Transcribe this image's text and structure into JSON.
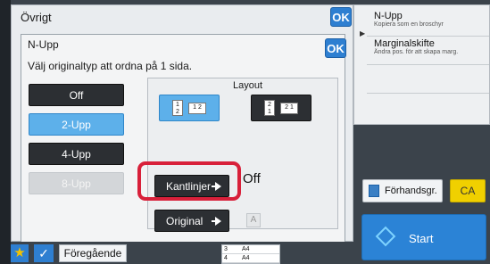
{
  "base_dialog": {
    "title": "Övrigt",
    "ok_label": "OK"
  },
  "dialog": {
    "title": "N-Upp",
    "ok_label": "OK",
    "instruction": "Välj originaltyp att ordna på 1 sida.",
    "options": [
      {
        "label": "Off",
        "state": "normal"
      },
      {
        "label": "2-Upp",
        "state": "selected"
      },
      {
        "label": "4-Upp",
        "state": "normal"
      },
      {
        "label": "8-Upp",
        "state": "disabled"
      }
    ],
    "layout_label": "Layout",
    "layout_options": [
      {
        "pages": [
          "1",
          "2"
        ],
        "order": "1 2",
        "state": "selected"
      },
      {
        "pages": [
          "2",
          "1"
        ],
        "order": "2 1",
        "state": "normal"
      }
    ],
    "border_button": "Kantlinjer",
    "border_value": "Off",
    "original_button": "Original",
    "a_label": "A"
  },
  "side_list": {
    "items": [
      {
        "title": "N-Upp",
        "subtitle": "Kopiera som en broschyr"
      },
      {
        "title": "Marginalskifte",
        "subtitle": "Ändra pos. för att skapa marg."
      }
    ]
  },
  "actions": {
    "preview": "Förhandsgr.",
    "ca": "CA",
    "start": "Start"
  },
  "bottom": {
    "previous": "Föregående",
    "paper_rows": [
      {
        "tray": "3",
        "size": "A4"
      },
      {
        "tray": "4",
        "size": "A4"
      }
    ]
  },
  "colors": {
    "accent_blue": "#2e7fd1",
    "selected_blue": "#5db0ea",
    "highlight_red": "#d8203a",
    "ca_yellow": "#f0d000"
  },
  "icons": [
    "star-icon",
    "check-icon",
    "arrow-right-icon",
    "preview-icon",
    "start-icon"
  ]
}
